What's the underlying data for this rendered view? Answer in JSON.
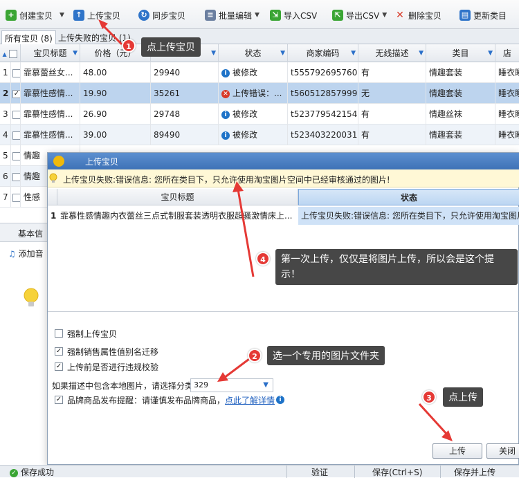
{
  "toolbar": {
    "create": "创建宝贝",
    "upload": "上传宝贝",
    "sync": "同步宝贝",
    "batch_edit": "批量编辑",
    "import_csv": "导入CSV",
    "export_csv": "导出CSV",
    "delete": "删除宝贝",
    "update_category": "更新类目"
  },
  "tabs": {
    "all": "所有宝贝 (8)",
    "failed": "上传失败的宝贝 (1)"
  },
  "grid": {
    "columns": [
      "宝贝标题",
      "价格（元）",
      "数量",
      "状态",
      "商家编码",
      "无线描述",
      "类目",
      "店"
    ],
    "rows": [
      {
        "num": "1",
        "title": "霏慕蕾丝女...",
        "price": "48.00",
        "qty": "29940",
        "status": "被修改",
        "code": "t555792695760",
        "wireless": "有",
        "category": "情趣套装",
        "shop": "睡衣睡"
      },
      {
        "num": "2",
        "title": "霏慕性感情...",
        "price": "19.90",
        "qty": "35261",
        "status": "上传错误：...",
        "code": "t560512857999",
        "wireless": "无",
        "category": "情趣套装",
        "shop": "睡衣睡"
      },
      {
        "num": "3",
        "title": "霏慕性感情...",
        "price": "26.90",
        "qty": "29748",
        "status": "被修改",
        "code": "t523779542154",
        "wireless": "有",
        "category": "情趣丝袜",
        "shop": "睡衣睡"
      },
      {
        "num": "4",
        "title": "霏慕性感情...",
        "price": "39.00",
        "qty": "89490",
        "status": "被修改",
        "code": "t523403220031",
        "wireless": "有",
        "category": "情趣套装",
        "shop": "睡衣睡"
      },
      {
        "num": "5",
        "title": "情趣"
      },
      {
        "num": "6",
        "title": "情趣"
      },
      {
        "num": "7",
        "title": "性感"
      }
    ]
  },
  "lower": {
    "tab": "基本信",
    "add_audio": "添加音"
  },
  "dialog": {
    "title": "上传宝贝",
    "warning": "上传宝贝失败:错误信息: 您所在类目下，只允许使用淘宝图片空间中已经审核通过的图片!",
    "col_title": "宝贝标题",
    "col_status": "状态",
    "row_num": "1",
    "row_title": "霏慕性感情趣内衣蕾丝三点式制服套装透明衣服超骚激情床上...",
    "row_status": "上传宝贝失败:错误信息: 您所在类目下，只允许使用淘宝图片",
    "opt_force": "强制上传宝贝",
    "opt_alias": "强制销售属性值别名迁移",
    "opt_check": "上传前是否进行违规校验",
    "local_img_label": "如果描述中包含本地图片，请选择分类",
    "select_value": "329",
    "brand_label": "品牌商品发布提醒：请谨慎发布品牌商品，",
    "brand_link": "点此了解详情",
    "upload_btn": "上传",
    "close_btn": "关闭"
  },
  "statusbar": {
    "saved": "保存成功",
    "verify": "验证",
    "save": "保存(Ctrl+S)",
    "save_upload": "保存并上传"
  },
  "annotations": {
    "b1": "1",
    "c1": "点上传宝贝",
    "b2": "2",
    "c2": "选一个专用的图片文件夹",
    "b3": "3",
    "c3": "点上传",
    "b4": "4",
    "c4": "第一次上传，仅仅是将图片上传，所以会是这个提示！"
  },
  "colors": {
    "accent": "#3e72b6",
    "annotation": "#e53935",
    "callout_bg": "#474747"
  }
}
